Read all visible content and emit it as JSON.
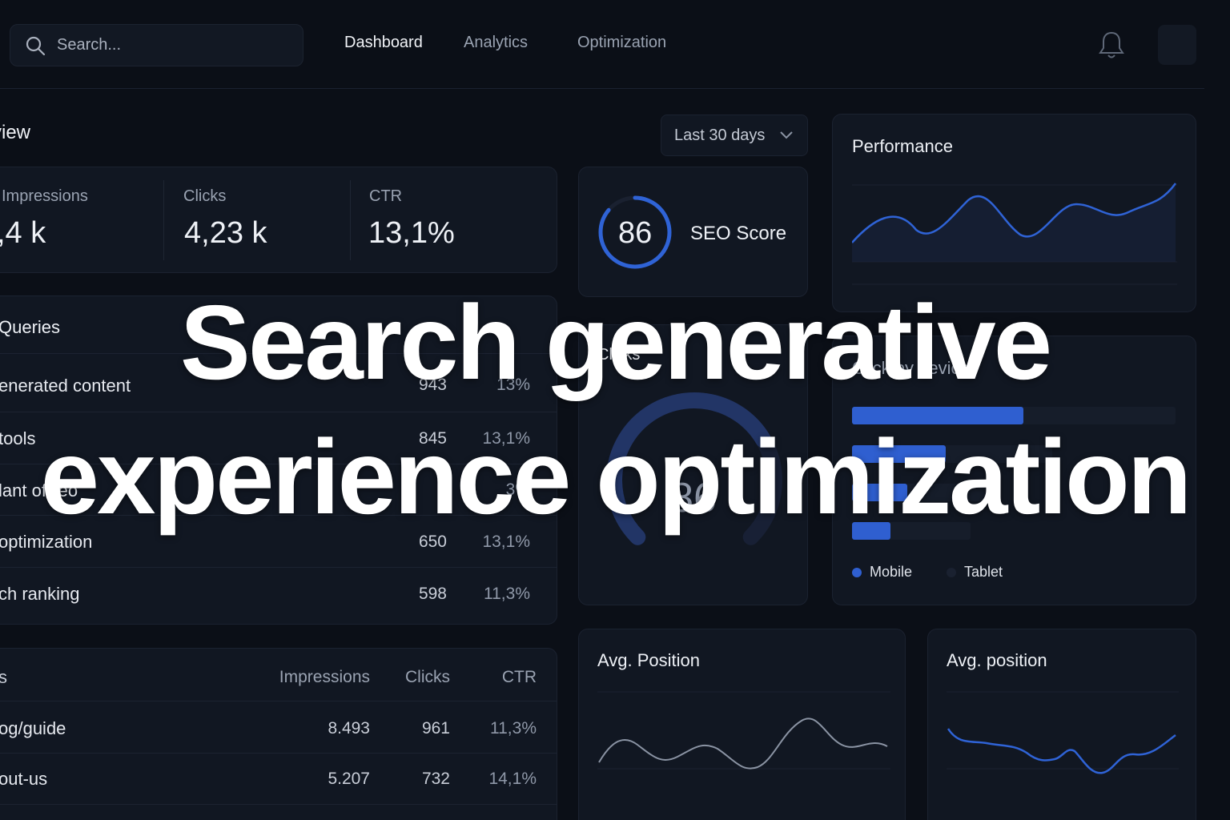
{
  "header": {
    "search_placeholder": "Search...",
    "nav": [
      "Dashboard",
      "Analytics",
      "Optimization"
    ],
    "active_nav": "Dashboard"
  },
  "overview": {
    "title": "view",
    "date_range": "Last 30 days",
    "stats": [
      {
        "label": "Impressions",
        "value": ",4 k"
      },
      {
        "label": "Clicks",
        "value": "4,23 k"
      },
      {
        "label": "CTR",
        "value": "13,1%"
      }
    ]
  },
  "seo_score": {
    "value": "86",
    "label": "SEO Score",
    "fraction": 0.86
  },
  "performance": {
    "title": "Performance"
  },
  "queries": {
    "title": "Queries",
    "rows": [
      {
        "query": "enerated content",
        "count": "943",
        "pct": "13%"
      },
      {
        "query": "tools",
        "count": "845",
        "pct": "13,1%"
      },
      {
        "query": "lant ofSeo",
        "count": "",
        "pct": "3%"
      },
      {
        "query": "optimization",
        "count": "650",
        "pct": "13,1%"
      },
      {
        "query": "ch ranking",
        "count": "598",
        "pct": "11,3%"
      }
    ]
  },
  "clicks_gauge": {
    "title": "Clicks",
    "value": "86",
    "fraction": 0.72
  },
  "device": {
    "title": "Click by device",
    "bars": [
      0.53,
      0.29,
      0.17,
      0.12
    ],
    "legend": [
      "Mobile",
      "Tablet"
    ],
    "colors": {
      "mobile": "#2f5fd0",
      "tablet": "#1a2130"
    }
  },
  "pages": {
    "title": "s",
    "columns": [
      "Impressions",
      "Clicks",
      "CTR"
    ],
    "rows": [
      {
        "page": "og/guide",
        "impressions": "8.493",
        "clicks": "961",
        "ctr": "11,3%"
      },
      {
        "page": "out-us",
        "impressions": "5.207",
        "clicks": "732",
        "ctr": "14,1%"
      }
    ]
  },
  "avg_position_1": {
    "title": "Avg. Position"
  },
  "avg_position_2": {
    "title": "Avg. position"
  },
  "overlay": {
    "line1": "Search generative",
    "line2": "experience optimization"
  },
  "colors": {
    "accent": "#2f63d6",
    "background": "#0b0f17",
    "card": "#111722"
  }
}
